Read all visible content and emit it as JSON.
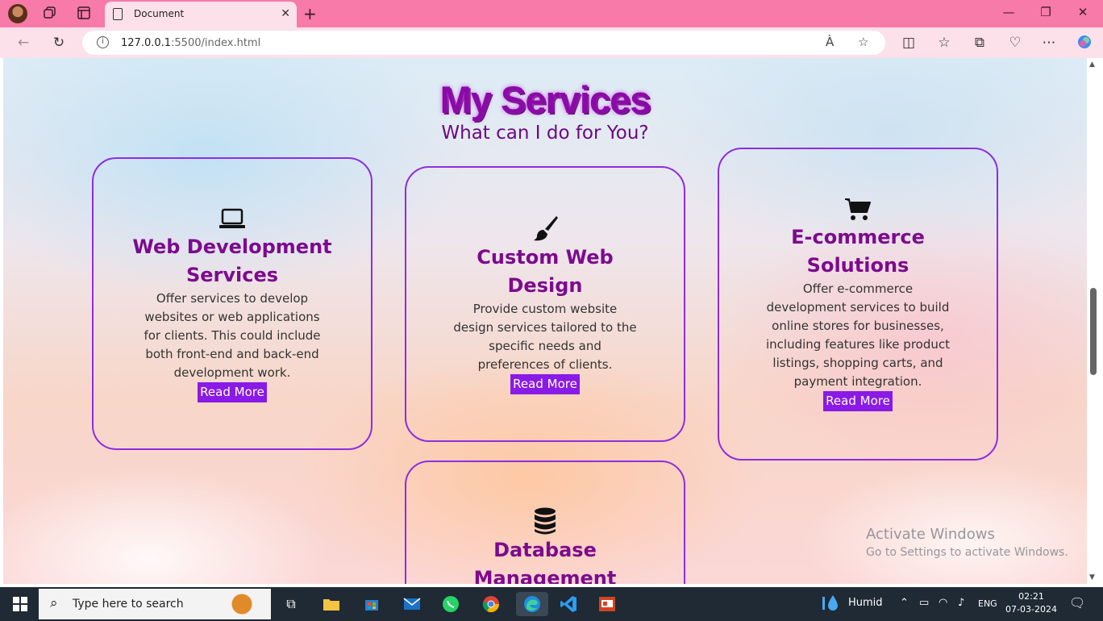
{
  "browser": {
    "tab_title": "Document",
    "url_host": "127.0.0.1",
    "url_path": ":5500/index.html",
    "read_aloud_icon": "À"
  },
  "page": {
    "heading": "My Services",
    "subheading": "What can I do for You?",
    "cards": [
      {
        "icon": "laptop-icon",
        "title": "Web Development Services",
        "description": "Offer services to develop websites or web applications for clients. This could include both front-end and back-end development work.",
        "button": "Read More"
      },
      {
        "icon": "paintbrush-icon",
        "title": "Custom Web Design",
        "description": "Provide custom website design services tailored to the specific needs and preferences of clients.",
        "button": "Read More"
      },
      {
        "icon": "shopping-cart-icon",
        "title": "E-commerce Solutions",
        "description": "Offer e-commerce development services to build online stores for businesses, including features like product listings, shopping carts, and payment integration.",
        "button": "Read More"
      },
      {
        "icon": "database-icon",
        "title": "Database Management",
        "description": "",
        "button": ""
      }
    ],
    "watermark_line1": "Activate Windows",
    "watermark_line2": "Go to Settings to activate Windows."
  },
  "taskbar": {
    "search_placeholder": "Type here to search",
    "weather": "Humid",
    "language": "ENG",
    "time": "02:21",
    "date": "07-03-2024"
  },
  "colors": {
    "accent_purple": "#8a1ae6",
    "title_purple": "#7d0a8e",
    "titlebar_pink": "#f77aa8"
  }
}
